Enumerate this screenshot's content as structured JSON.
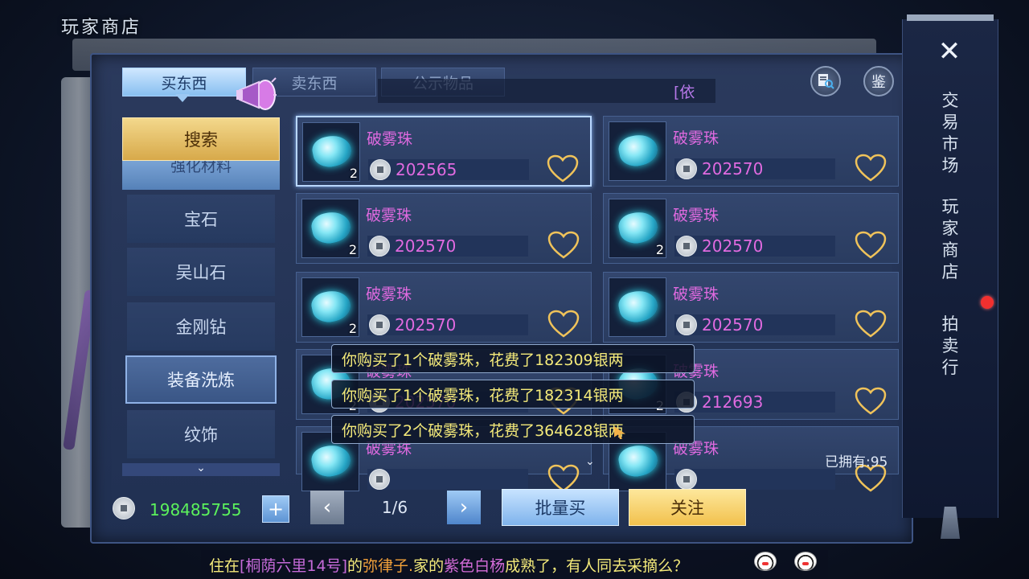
{
  "window": {
    "title": "玩家商店"
  },
  "tabs": [
    {
      "label": "买东西",
      "active": true
    },
    {
      "label": "卖东西",
      "active": false
    },
    {
      "label": "公示物品",
      "active": false
    }
  ],
  "notice_fragment": "[依",
  "header_buttons": {
    "inspect_label": "鉴"
  },
  "sidebar": {
    "search_label": "搜索",
    "partial_item": "强化材料",
    "items": [
      {
        "label": "宝石",
        "selected": false
      },
      {
        "label": "吴山石",
        "selected": false
      },
      {
        "label": "金刚钻",
        "selected": false
      },
      {
        "label": "装备洗炼",
        "selected": true
      },
      {
        "label": "纹饰",
        "selected": false
      }
    ],
    "more_glyph": "⌄"
  },
  "items": [
    {
      "name": "破雾珠",
      "qty": "2",
      "price": "202565",
      "selected": true
    },
    {
      "name": "破雾珠",
      "qty": "",
      "price": "202570",
      "selected": false
    },
    {
      "name": "破雾珠",
      "qty": "2",
      "price": "202570",
      "selected": false
    },
    {
      "name": "破雾珠",
      "qty": "2",
      "price": "202570",
      "selected": false
    },
    {
      "name": "破雾珠",
      "qty": "2",
      "price": "202570",
      "selected": false
    },
    {
      "name": "破雾珠",
      "qty": "",
      "price": "202570",
      "selected": false
    },
    {
      "name": "破雾珠",
      "qty": "2",
      "price": "202570",
      "selected": false
    },
    {
      "name": "破雾珠",
      "qty": "2",
      "price": "212693",
      "selected": false
    },
    {
      "name": "破雾珠",
      "qty": "",
      "price": "",
      "selected": false
    },
    {
      "name": "破雾珠",
      "qty": "",
      "price": "",
      "selected": false
    }
  ],
  "system_messages": [
    "你购买了1个破雾珠，花费了182309银两",
    "你购买了1个破雾珠，花费了182314银两",
    "你购买了2个破雾珠，花费了364628银两"
  ],
  "owned_label": "已拥有:95",
  "list_more_glyph": "⌄",
  "bottom": {
    "wallet_value": "198485755",
    "plus_label": "+",
    "prev_label": "‹",
    "next_label": "›",
    "page_indicator": "1/6",
    "bulk_buy_label": "批量买",
    "follow_label": "关注"
  },
  "chat": {
    "p1": "住在",
    "location": "[桐荫六里14号]",
    "p2": "的",
    "player": "弥律子.",
    "p3": "家的",
    "plant": "紫色白杨",
    "p4": "成熟了，有人同去采摘么？"
  },
  "right_nav": {
    "close_label": "✕",
    "items": [
      "交易市场",
      "玩家商店",
      "拍卖行"
    ]
  },
  "colors": {
    "price": "#e06ae0",
    "wallet": "#5cf25c",
    "system_text": "#f4ea7a",
    "active_tab": "#88bff0",
    "gold_button": "#f2c14d"
  }
}
